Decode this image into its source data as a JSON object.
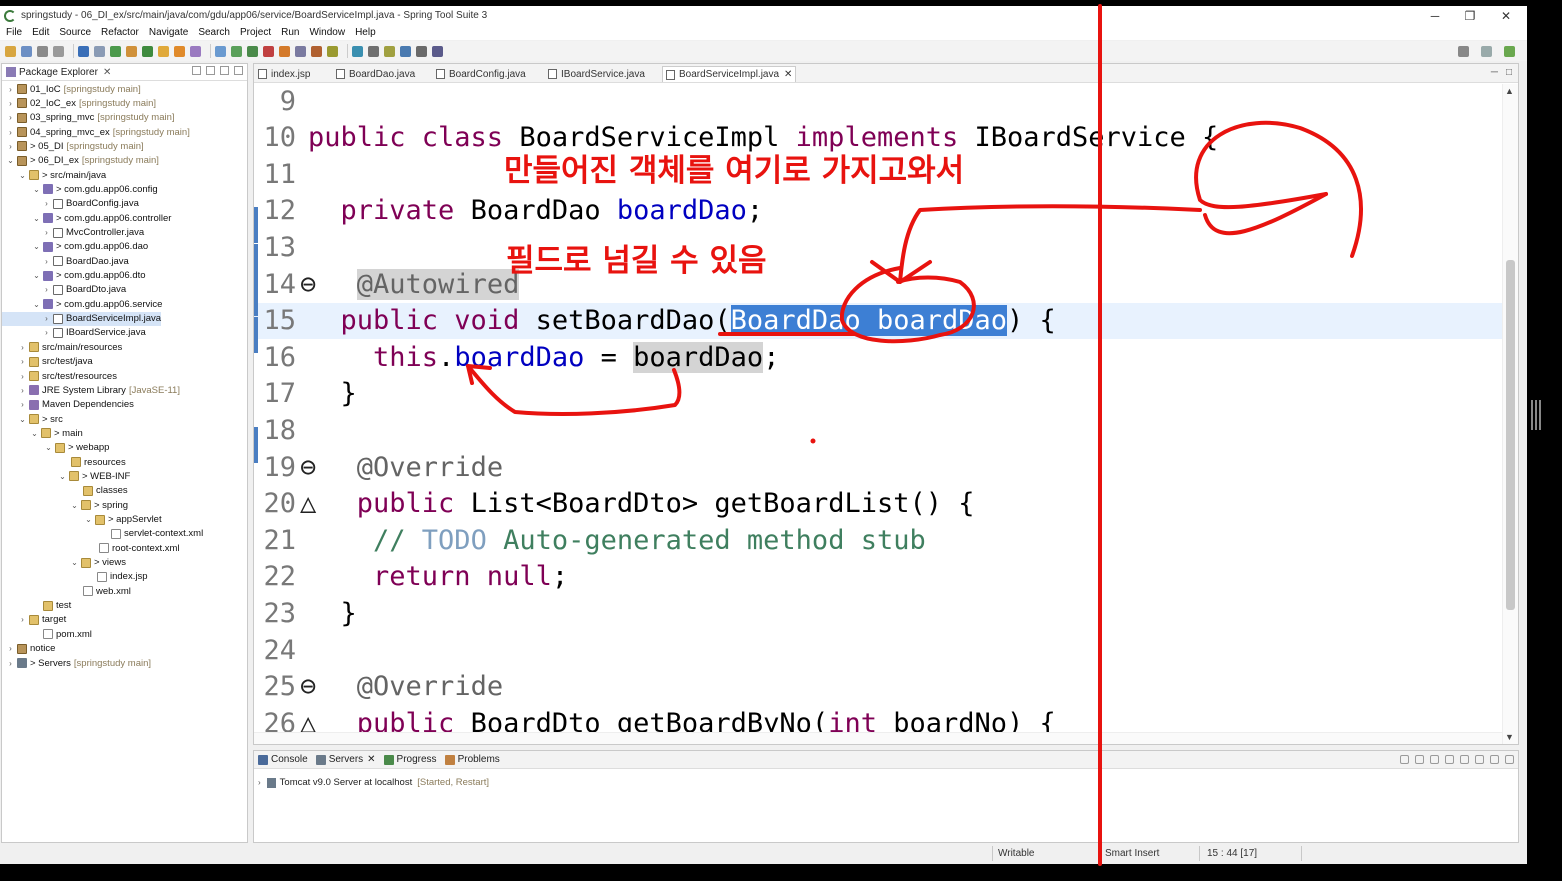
{
  "window": {
    "title": "springstudy - 06_DI_ex/src/main/java/com/gdu/app06/service/BoardServiceImpl.java - Spring Tool Suite 3",
    "controls": [
      "─",
      "❐",
      "✕"
    ]
  },
  "menu": [
    "File",
    "Edit",
    "Source",
    "Refactor",
    "Navigate",
    "Search",
    "Project",
    "Run",
    "Window",
    "Help"
  ],
  "package_explorer": {
    "title": "Package Explorer",
    "tree": [
      {
        "label": "01_IoC",
        "deco": "[springstudy main]",
        "icon": "proj",
        "twisty": "›"
      },
      {
        "label": "02_IoC_ex",
        "deco": "[springstudy main]",
        "icon": "proj",
        "twisty": "›"
      },
      {
        "label": "03_spring_mvc",
        "deco": "[springstudy main]",
        "icon": "proj",
        "twisty": "›"
      },
      {
        "label": "04_spring_mvc_ex",
        "deco": "[springstudy main]",
        "icon": "proj",
        "twisty": "›"
      },
      {
        "label": "> 05_DI",
        "deco": "[springstudy main]",
        "icon": "proj",
        "twisty": "›"
      },
      {
        "label": "> 06_DI_ex",
        "deco": "[springstudy main]",
        "icon": "proj",
        "twisty": "⌄"
      },
      {
        "label": "> src/main/java",
        "deco": "",
        "icon": "folder",
        "twisty": "⌄"
      },
      {
        "label": "> com.gdu.app06.config",
        "deco": "",
        "icon": "pkg",
        "twisty": "⌄"
      },
      {
        "label": "BoardConfig.java",
        "deco": "",
        "icon": "java",
        "twisty": "›"
      },
      {
        "label": "> com.gdu.app06.controller",
        "deco": "",
        "icon": "pkg",
        "twisty": "⌄"
      },
      {
        "label": "MvcController.java",
        "deco": "",
        "icon": "java",
        "twisty": "›"
      },
      {
        "label": "> com.gdu.app06.dao",
        "deco": "",
        "icon": "pkg",
        "twisty": "⌄"
      },
      {
        "label": "BoardDao.java",
        "deco": "",
        "icon": "java",
        "twisty": "›"
      },
      {
        "label": "> com.gdu.app06.dto",
        "deco": "",
        "icon": "pkg",
        "twisty": "⌄"
      },
      {
        "label": "BoardDto.java",
        "deco": "",
        "icon": "java",
        "twisty": "›"
      },
      {
        "label": "> com.gdu.app06.service",
        "deco": "",
        "icon": "pkg",
        "twisty": "⌄"
      },
      {
        "label": "BoardServiceImpl.java",
        "deco": "",
        "icon": "java",
        "twisty": "›",
        "selected": true
      },
      {
        "label": "IBoardService.java",
        "deco": "",
        "icon": "java",
        "twisty": "›"
      },
      {
        "label": "src/main/resources",
        "deco": "",
        "icon": "folder",
        "twisty": "›"
      },
      {
        "label": "src/test/java",
        "deco": "",
        "icon": "folder",
        "twisty": "›"
      },
      {
        "label": "src/test/resources",
        "deco": "",
        "icon": "folder",
        "twisty": "›"
      },
      {
        "label": "JRE System Library",
        "deco": "[JavaSE-11]",
        "icon": "lib",
        "twisty": "›"
      },
      {
        "label": "Maven Dependencies",
        "deco": "",
        "icon": "lib",
        "twisty": "›"
      },
      {
        "label": "> src",
        "deco": "",
        "icon": "folder",
        "twisty": "⌄"
      },
      {
        "label": "> main",
        "deco": "",
        "icon": "folder",
        "twisty": "⌄"
      },
      {
        "label": "> webapp",
        "deco": "",
        "icon": "folder",
        "twisty": "⌄"
      },
      {
        "label": "resources",
        "deco": "",
        "icon": "folder",
        "twisty": ""
      },
      {
        "label": "> WEB-INF",
        "deco": "",
        "icon": "folder",
        "twisty": "⌄"
      },
      {
        "label": "classes",
        "deco": "",
        "icon": "folder",
        "twisty": ""
      },
      {
        "label": "> spring",
        "deco": "",
        "icon": "folder",
        "twisty": "⌄"
      },
      {
        "label": "> appServlet",
        "deco": "",
        "icon": "folder",
        "twisty": "⌄"
      },
      {
        "label": "servlet-context.xml",
        "deco": "",
        "icon": "xml",
        "twisty": ""
      },
      {
        "label": "root-context.xml",
        "deco": "",
        "icon": "xml",
        "twisty": ""
      },
      {
        "label": "> views",
        "deco": "",
        "icon": "folder",
        "twisty": "⌄"
      },
      {
        "label": "index.jsp",
        "deco": "",
        "icon": "xml",
        "twisty": ""
      },
      {
        "label": "web.xml",
        "deco": "",
        "icon": "xml",
        "twisty": ""
      },
      {
        "label": "test",
        "deco": "",
        "icon": "folder",
        "twisty": ""
      },
      {
        "label": "target",
        "deco": "",
        "icon": "folder",
        "twisty": "›"
      },
      {
        "label": "pom.xml",
        "deco": "",
        "icon": "xml",
        "twisty": ""
      },
      {
        "label": "notice",
        "deco": "",
        "icon": "proj",
        "twisty": "›"
      },
      {
        "label": "> Servers",
        "deco": "[springstudy main]",
        "icon": "server",
        "twisty": "›"
      }
    ]
  },
  "editor": {
    "tabs": [
      "index.jsp",
      "BoardDao.java",
      "BoardConfig.java",
      "IBoardService.java",
      "BoardServiceImpl.java"
    ],
    "active_tab": "BoardServiceImpl.java",
    "lines": [
      {
        "num": "9",
        "segs": []
      },
      {
        "num": "10",
        "segs": [
          {
            "t": "public class ",
            "c": "kw"
          },
          {
            "t": "BoardServiceImpl ",
            "c": ""
          },
          {
            "t": "implements ",
            "c": "kw"
          },
          {
            "t": "IBoardService {",
            "c": ""
          }
        ]
      },
      {
        "num": "11",
        "segs": []
      },
      {
        "num": "12",
        "segs": [
          {
            "t": "  private ",
            "c": "kw"
          },
          {
            "t": "BoardDao ",
            "c": ""
          },
          {
            "t": "boardDao",
            "c": "fld"
          },
          {
            "t": ";",
            "c": ""
          }
        ]
      },
      {
        "num": "13",
        "segs": []
      },
      {
        "num": "14",
        "fold": "⊖",
        "segs": [
          {
            "t": "  ",
            "c": ""
          },
          {
            "t": "@Autowired",
            "c": "ann ann-hl"
          }
        ]
      },
      {
        "num": "15",
        "highlight": true,
        "segs": [
          {
            "t": "  public void ",
            "c": "kw"
          },
          {
            "t": "setBoardDao(",
            "c": ""
          },
          {
            "t": "BoardDao boardDao",
            "c": "sel-hl"
          },
          {
            "t": ") {",
            "c": ""
          }
        ]
      },
      {
        "num": "16",
        "segs": [
          {
            "t": "    this",
            "c": "kw"
          },
          {
            "t": ".",
            "c": ""
          },
          {
            "t": "boardDao",
            "c": "fld"
          },
          {
            "t": " = ",
            "c": ""
          },
          {
            "t": "boardDao",
            "c": "mark-hl"
          },
          {
            "t": ";",
            "c": ""
          }
        ]
      },
      {
        "num": "17",
        "segs": [
          {
            "t": "  }",
            "c": ""
          }
        ]
      },
      {
        "num": "18",
        "segs": []
      },
      {
        "num": "19",
        "fold": "⊖",
        "segs": [
          {
            "t": "  ",
            "c": ""
          },
          {
            "t": "@Override",
            "c": "ann"
          }
        ]
      },
      {
        "num": "20",
        "fold": "△",
        "segs": [
          {
            "t": "  public ",
            "c": "kw"
          },
          {
            "t": "List<BoardDto> getBoardList() {",
            "c": ""
          }
        ]
      },
      {
        "num": "21",
        "segs": [
          {
            "t": "    // ",
            "c": "cmt"
          },
          {
            "t": "TODO",
            "c": "todo"
          },
          {
            "t": " Auto-generated method stub",
            "c": "cmt"
          }
        ]
      },
      {
        "num": "22",
        "segs": [
          {
            "t": "    return null",
            "c": "kw"
          },
          {
            "t": ";",
            "c": ""
          }
        ]
      },
      {
        "num": "23",
        "segs": [
          {
            "t": "  }",
            "c": ""
          }
        ]
      },
      {
        "num": "24",
        "segs": []
      },
      {
        "num": "25",
        "fold": "⊖",
        "segs": [
          {
            "t": "  ",
            "c": ""
          },
          {
            "t": "@Override",
            "c": "ann"
          }
        ]
      },
      {
        "num": "26",
        "fold": "△",
        "segs": [
          {
            "t": "  public ",
            "c": "kw"
          },
          {
            "t": "BoardDto getBoardByNo(",
            "c": ""
          },
          {
            "t": "int ",
            "c": "kw"
          },
          {
            "t": "boardNo) {",
            "c": ""
          }
        ]
      }
    ]
  },
  "console": {
    "tabs": [
      "Console",
      "Servers",
      "Progress",
      "Problems"
    ],
    "server_row": "Tomcat v9.0 Server at localhost",
    "server_status": "[Started, Restart]"
  },
  "statusbar": {
    "writable": "Writable",
    "insert_mode": "Smart Insert",
    "position": "15 : 44 [17]"
  },
  "annotations": {
    "note1": "만들어진 객체를 여기로 가지고와서",
    "note2": "필드로 넘길 수 있음",
    "ink_color": "#e8130f"
  }
}
